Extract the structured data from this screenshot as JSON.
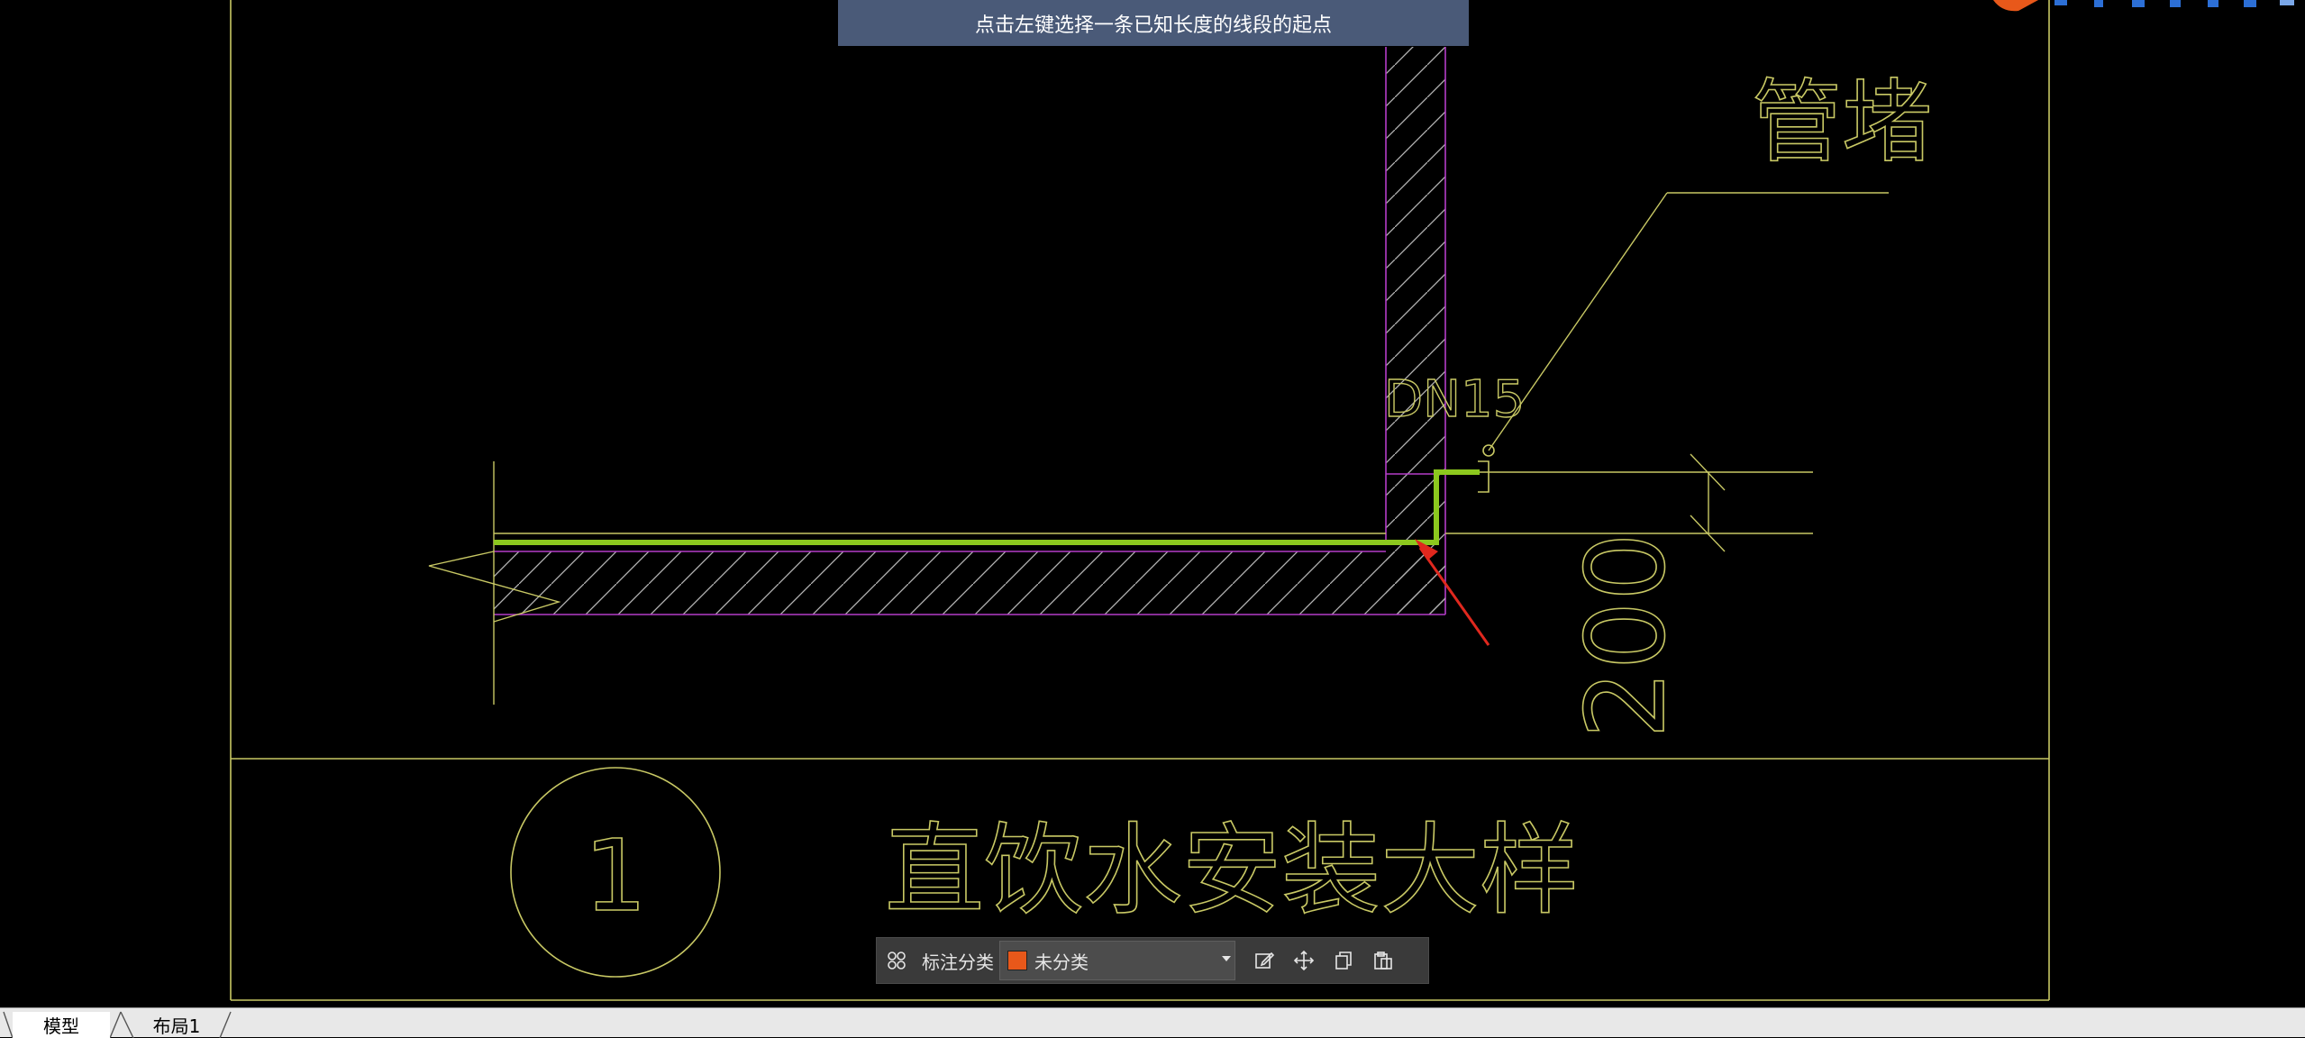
{
  "prompt": {
    "text": "点击左键选择一条已知长度的线段的起点"
  },
  "drawing": {
    "label_pipe_cap": "管堵",
    "label_dn": "DN15",
    "dimension_value": "200",
    "detail_number": "1",
    "detail_title": "直饮水安装大样",
    "colors": {
      "frame": "#c8c864",
      "wall_outline": "#b43cc8",
      "pipe": "#8cc81e",
      "leader": "#c8c864",
      "arrow": "#e0281e",
      "hatch": "#b4b4b4"
    }
  },
  "annotation_toolbar": {
    "category_label": "标注分类",
    "category_value": "未分类",
    "category_color": "#e8581a",
    "icons": [
      "layout-grid-icon",
      "edit-icon",
      "move-icon",
      "copy-icon",
      "paste-icon"
    ]
  },
  "tabs": [
    {
      "label": "模型",
      "active": true
    },
    {
      "label": "布局1",
      "active": false
    }
  ]
}
